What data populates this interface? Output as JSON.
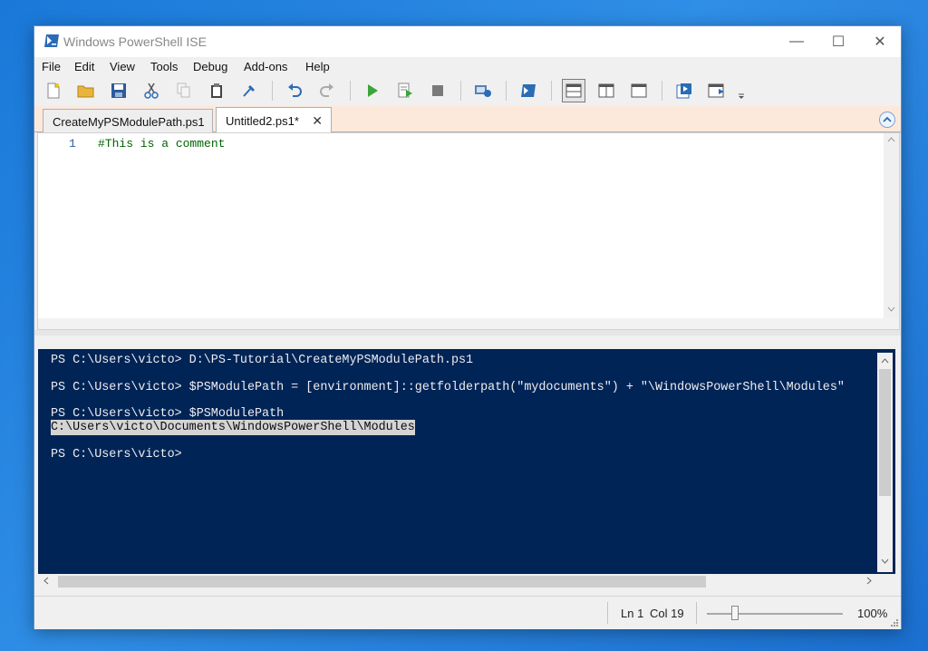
{
  "window": {
    "title": "Windows PowerShell ISE",
    "minimize_glyph": "—",
    "maximize_glyph": "☐",
    "close_glyph": "✕"
  },
  "menu": [
    "File",
    "Edit",
    "View",
    "Tools",
    "Debug",
    "Add-ons",
    "Help"
  ],
  "toolbar": {
    "icons": [
      "new-file-icon",
      "open-folder-icon",
      "save-icon",
      "cut-icon",
      "copy-icon",
      "paste-icon",
      "clear-console-icon",
      "undo-icon",
      "redo-icon",
      "run-script-icon",
      "run-selection-icon",
      "stop-icon",
      "new-remote-tab-icon",
      "start-powershell-icon",
      "show-script-pane-top-icon",
      "show-script-pane-right-icon",
      "show-script-pane-maximized-icon",
      "show-command-window-icon",
      "show-command-addon-icon"
    ]
  },
  "tabs": [
    {
      "label": "CreateMyPSModulePath.ps1",
      "active": false
    },
    {
      "label": "Untitled2.ps1*",
      "active": true,
      "close_glyph": "✕"
    }
  ],
  "editor": {
    "line_number": "1",
    "code": "#This is a comment"
  },
  "console": {
    "lines": [
      "PS C:\\Users\\victo> D:\\PS-Tutorial\\CreateMyPSModulePath.ps1",
      "PS C:\\Users\\victo> $PSModulePath = [environment]::getfolderpath(\"mydocuments\") + \"\\WindowsPowerShell\\Modules\"",
      "PS C:\\Users\\victo> $PSModulePath",
      "C:\\Users\\victo\\Documents\\WindowsPowerShell\\Modules",
      "PS C:\\Users\\victo>"
    ]
  },
  "status": {
    "line": "Ln 1",
    "col": "Col 19",
    "zoom": "100%"
  },
  "colors": {
    "console_bg": "#012456",
    "console_text": "#eeedf0",
    "comment": "#006400",
    "tabstrip_bg": "#fde9dc"
  }
}
